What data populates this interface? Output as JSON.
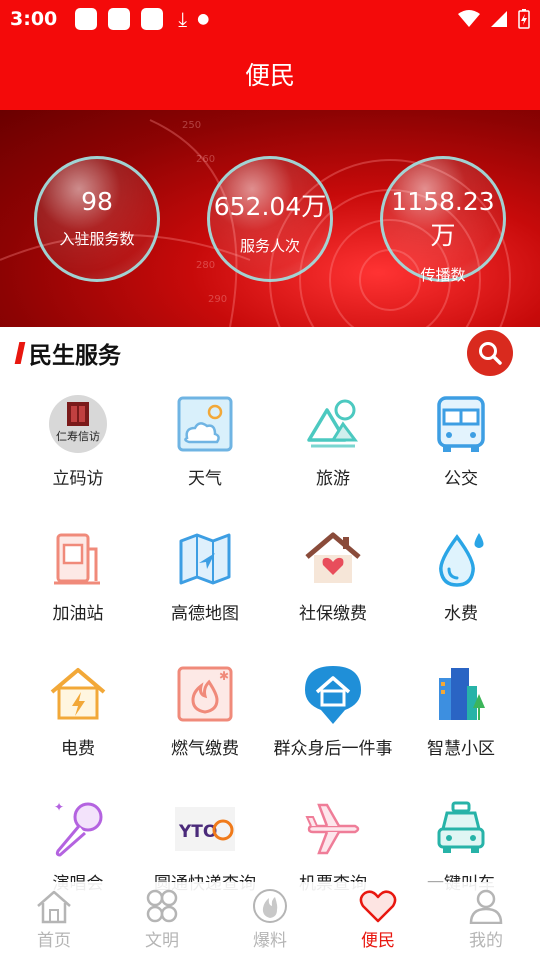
{
  "status_bar": {
    "time": "3:00"
  },
  "header": {
    "title": "便民"
  },
  "stats": [
    {
      "value": "98",
      "label": "入驻服务数"
    },
    {
      "value": "652.04万",
      "label": "服务人次"
    },
    {
      "value": "1158.23万",
      "label": "传播数"
    }
  ],
  "section": {
    "title": "民生服务"
  },
  "services": [
    {
      "label": "立码访",
      "icon": "rubber-stamp-logo-icon"
    },
    {
      "label": "天气",
      "icon": "weather-icon"
    },
    {
      "label": "旅游",
      "icon": "mountain-icon"
    },
    {
      "label": "公交",
      "icon": "bus-icon"
    },
    {
      "label": "加油站",
      "icon": "gas-pump-icon"
    },
    {
      "label": "高德地图",
      "icon": "map-icon"
    },
    {
      "label": "社保缴费",
      "icon": "house-heart-icon"
    },
    {
      "label": "水费",
      "icon": "water-drop-icon"
    },
    {
      "label": "电费",
      "icon": "house-lightning-icon"
    },
    {
      "label": "燃气缴费",
      "icon": "flame-icon"
    },
    {
      "label": "群众身后一件事",
      "icon": "location-house-icon"
    },
    {
      "label": "智慧小区",
      "icon": "buildings-icon"
    },
    {
      "label": "演唱会",
      "icon": "microphone-icon"
    },
    {
      "label": "圆通快递查询",
      "icon": "yto-logo-icon"
    },
    {
      "label": "机票查询",
      "icon": "airplane-icon"
    },
    {
      "label": "一键叫车",
      "icon": "taxi-icon"
    }
  ],
  "service_icon_text": {
    "lima": "仁寿信访",
    "yto": "YTO"
  },
  "bottom_nav": [
    {
      "label": "首页",
      "icon": "home-icon",
      "active": false
    },
    {
      "label": "文明",
      "icon": "clover-icon",
      "active": false
    },
    {
      "label": "爆料",
      "icon": "flame-icon",
      "active": false
    },
    {
      "label": "便民",
      "icon": "heart-icon",
      "active": true
    },
    {
      "label": "我的",
      "icon": "user-icon",
      "active": false
    }
  ],
  "colors": {
    "primary": "#f40a0a",
    "accent": "#e8170f",
    "inactive": "#b5b5b5"
  }
}
